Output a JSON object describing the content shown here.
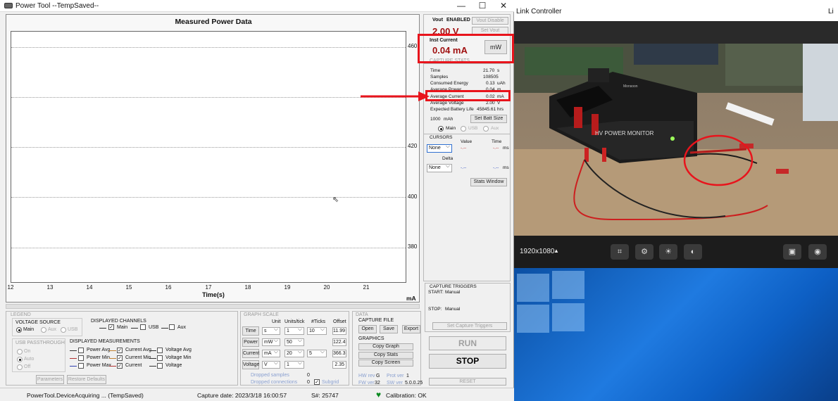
{
  "powertool": {
    "title": "Power Tool --TempSaved--",
    "window_controls": {
      "minimize": "—",
      "maximize": "☐",
      "close": "✕"
    },
    "graph": {
      "title": "Measured Power Data",
      "xlabel": "Time(s)",
      "yunit": "mA"
    },
    "vout": {
      "label": "Vout",
      "status": "ENABLED",
      "value": "2.00 V",
      "btn_disable": "Vout Disable",
      "btn_set": "Set Vout"
    },
    "inst_current": {
      "label": "Inst Current",
      "value": "0.04 mA",
      "unit_btn": "mW"
    },
    "capture_stats": {
      "header": "CAPTURE STATS",
      "rows": [
        {
          "label": "Time",
          "value": "21.70",
          "unit": "s"
        },
        {
          "label": "Samples",
          "value": "108505",
          "unit": ""
        },
        {
          "label": "Consumed Energy",
          "value": "0.13",
          "unit": "uAh"
        },
        {
          "label": "Average Power",
          "value": "0.04",
          "unit": "m"
        },
        {
          "label": "Average Current",
          "value": "0.02",
          "unit": "mA"
        },
        {
          "label": "Average Voltage",
          "value": "2.00",
          "unit": "V"
        },
        {
          "label": "Expected Battery Life",
          "value": "45845.61",
          "unit": "hrs"
        }
      ],
      "batt_value": "1000",
      "batt_unit": "mAh",
      "batt_btn": "Set Batt Size",
      "channels": [
        "Main",
        "USB",
        "Aux"
      ]
    },
    "cursors": {
      "header": "CURSORS",
      "value_col": "Value",
      "time_col": "Time",
      "cursor1": "None",
      "cursor2": "None",
      "delta": "Delta",
      "dash": "-.--",
      "unit": "ms",
      "stats_btn": "Stats Window"
    },
    "triggers": {
      "header": "CAPTURE TRIGGERS",
      "start_label": "START:",
      "start_value": "Manual",
      "stop_label": "STOP:",
      "stop_value": "Manual",
      "set_btn": "Set Capture Triggers"
    },
    "run_btn": "RUN",
    "stop_btn": "STOP",
    "reset_btn": "RESET",
    "legend": {
      "header": "LEGEND",
      "voltage_source": "VOLTAGE SOURCE",
      "sources": [
        "Main",
        "Aux",
        "USB"
      ],
      "displayed_channels": "DISPLAYED CHANNELS",
      "channels": [
        "Main",
        "USB",
        "Aux"
      ],
      "usb_passthrough": "USB PASSTHROUGH",
      "passthrough": [
        "On",
        "Auto",
        "Off"
      ],
      "displayed_measurements": "DISPLAYED MEASUREMENTS",
      "measurements": [
        "Power Avg",
        "Power Min",
        "Power Max",
        "Current Avg",
        "Current Min",
        "Current",
        "Voltage Avg",
        "Voltage Min",
        "Voltage"
      ],
      "parameters_btn": "Parameters",
      "restore_btn": "Restore Defaults"
    },
    "graph_scale": {
      "header": "GRAPH SCALE",
      "col_unit": "Unit",
      "col_units_tick": "Units/tick",
      "col_ticks": "#Ticks",
      "col_offset": "Offset",
      "rows": [
        {
          "label": "Time",
          "unit": "s",
          "per_tick": "1",
          "ticks": "10",
          "offset": "11.99"
        },
        {
          "label": "Power",
          "unit": "mW",
          "per_tick": "50",
          "ticks": "",
          "offset": "122.4"
        },
        {
          "label": "Current",
          "unit": "mA",
          "per_tick": "20",
          "ticks": "5",
          "offset": "366.3"
        },
        {
          "label": "Voltage",
          "unit": "V",
          "per_tick": "1",
          "ticks": "",
          "offset": "2.35"
        }
      ],
      "dropped_samples": "Dropped samples",
      "dropped_samples_val": "0",
      "dropped_connections": "Dropped connections",
      "dropped_connections_val": "0",
      "subgrid": "Subgrid"
    },
    "data": {
      "header": "DATA",
      "capture_file": "CAPTURE FILE",
      "open": "Open",
      "save": "Save",
      "export": "Export",
      "graphics": "GRAPHICS",
      "copy_graph": "Copy Graph",
      "copy_stats": "Copy Stats",
      "copy_screen": "Copy Screen",
      "hw_rev": "HW rev",
      "hw_rev_val": "G",
      "prot_ver": "Prot ver",
      "prot_ver_val": "1",
      "fw_ver": "FW ver",
      "fw_ver_val": "32",
      "sw_ver": "SW ver",
      "sw_ver_val": "5.0.0.25"
    },
    "status": {
      "device": "PowerTool.DeviceAcquiring ... (TempSaved)",
      "capture_date": "Capture date: 2023/3/18 16:00:57",
      "serial": "S#: 25747",
      "calibration": "Calibration: OK"
    }
  },
  "link_controller": {
    "title": "Link Controller",
    "title2": "Li",
    "resolution": "1920x1080",
    "device_label": "HV POWER MONITOR",
    "brand_label": "Monsoon"
  },
  "colors": {
    "highlight": "#e8141c",
    "value_red": "#a01010"
  },
  "chart_data": {
    "type": "line",
    "title": "Measured Power Data",
    "xlabel": "Time(s)",
    "ylabel": "mA",
    "xlim": [
      12,
      22
    ],
    "ylim": [
      366,
      466
    ],
    "x_ticks": [
      12,
      13,
      14,
      15,
      16,
      17,
      18,
      19,
      20,
      21
    ],
    "y_ticks": [
      460,
      420,
      400,
      380
    ],
    "grid": true,
    "series": []
  }
}
